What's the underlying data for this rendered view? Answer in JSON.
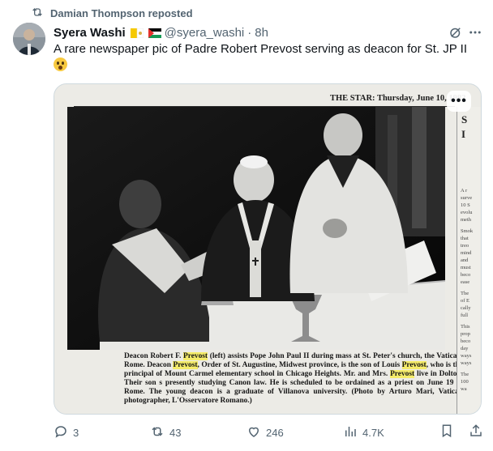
{
  "repost": {
    "label": "Damian Thompson reposted"
  },
  "author": {
    "name": "Syera Washi",
    "handle": "@syera_washi",
    "separator": "·",
    "time": "8h"
  },
  "tweet": {
    "text": "A rare newspaper pic of Padre Robert Prevost serving as deacon for St. JP II"
  },
  "media": {
    "newspaper_header": "THE STAR: Thursday, June 10, 1982",
    "caption_segments": [
      {
        "text": "Deacon Robert F. ",
        "hl": false
      },
      {
        "text": "Prevost",
        "hl": true
      },
      {
        "text": " (left) assists Pope John Paul II during mass at St. Peter's church, the Vatican, Rome. Deacon ",
        "hl": false
      },
      {
        "text": "Prevost",
        "hl": true
      },
      {
        "text": ", Order of St. Augustine, Midwest province, is the son of Louis ",
        "hl": false
      },
      {
        "text": "Prevost",
        "hl": true
      },
      {
        "text": ", who is the principal of Mount Carmel elementary school in Chicago Heights. Mr. and Mrs. ",
        "hl": false
      },
      {
        "text": "Prevost",
        "hl": true
      },
      {
        "text": " live in Dolton. Their son s presently studying Canon law. He is scheduled to be ordained as a priest on June 19 in Rome. The young deacon is a graduate of Villanova university. (Photo by Arturo Mari, Vatican photographer, L'Osservatore Romano.)",
        "hl": false
      }
    ],
    "side_column_letters": [
      "S",
      "I"
    ],
    "side_column_snippets": [
      "A r",
      "surve",
      "10 S",
      "evolu",
      "meth",
      "Smok",
      "that",
      "treo",
      "mind",
      "and",
      "must",
      "beco",
      "ease",
      "The",
      "of E",
      "cally",
      "full",
      "This",
      "prop",
      "beco",
      "day",
      "ways",
      "ways",
      "The",
      "100",
      "wa"
    ],
    "more_label": "•••"
  },
  "actions": {
    "replies": "3",
    "reposts": "43",
    "likes": "246",
    "views": "4.7K"
  },
  "colors": {
    "muted": "#536471",
    "text": "#0f1419",
    "highlight": "#f5ec6a"
  },
  "icons": [
    "repost-icon",
    "flag-vatican-icon",
    "flag-palestine-icon",
    "grok-icon",
    "more-icon",
    "reply-icon",
    "retweet-icon",
    "like-icon",
    "views-icon",
    "bookmark-icon",
    "share-icon",
    "astonished-emoji-icon"
  ]
}
